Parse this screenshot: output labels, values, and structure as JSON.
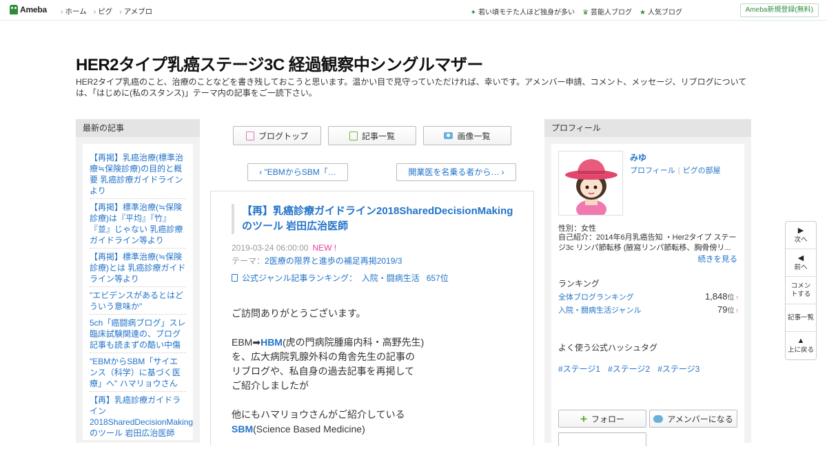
{
  "topbar": {
    "logo": "Ameba",
    "nav": [
      "ホーム",
      "ピグ",
      "アメブロ"
    ],
    "right_links": [
      {
        "icon": "sparkle-icon",
        "label": "若い頃モテた人ほど独身が多い"
      },
      {
        "icon": "crown-icon",
        "label": "芸能人ブログ"
      },
      {
        "icon": "star-icon",
        "label": "人気ブログ"
      }
    ],
    "signup": "Ameba新規登録(無料)"
  },
  "blog": {
    "title": "HER2タイプ乳癌ステージ3C 経過観察中シングルマザー",
    "description": "HER2タイプ乳癌のこと、治療のことなどを書き残しておこうと思います。温かい目で見守っていただければ、幸いです。アメンバー申請、コメント、メッセージ、リブログについては、「はじめに(私のスタンス)」テーマ内の記事をご一読下さい。"
  },
  "left": {
    "heading": "最新の記事",
    "recent": [
      "【再掲】乳癌治療(標準治療≒保険診療)の目的と概要 乳癌診療ガイドライン より",
      "【再掲】標準治療(≒保険診療)は『平均』『竹』『並』じゃない 乳癌診療ガイドライン等より",
      "【再掲】標準治療(≒保険診療)とは 乳癌診療ガイドライン等より",
      "\"エビデンスがあるとはどういう意味か\"",
      "5ch「癌闘病ブログ」スレ臨床試験関連の、ブログ記事も読まずの酷い中傷",
      "\"EBMからSBM「サイエンス（科学）に基づく医療」へ\" ハマリョウさん",
      "【再】乳癌診療ガイドライン2018SharedDecisionMakingのツール 岩田広治医師"
    ]
  },
  "main": {
    "buttons": {
      "top": "ブログトップ",
      "list": "記事一覧",
      "images": "画像一覧"
    },
    "prev": "\"EBMからSBM「…",
    "next": "開業医を名乗る者から…",
    "article": {
      "title": "【再】乳癌診療ガイドライン2018SharedDecisionMakingのツール 岩田広治医師",
      "date": "2019-03-24 06:00:00",
      "new_label": "NEW !",
      "theme_label": "テーマ：",
      "theme": "2医療の限界と進歩の補足再掲2019/3",
      "ranking": "公式ジャンル記事ランキング：  入院・闘病生活   657位",
      "p1": "ご訪問ありがとうございます。",
      "p2_pre": "EBM➡",
      "p2_link": "HBM",
      "p2_post": "(虎の門病院腫瘍内科・高野先生)",
      "p2_l2": "を、広大病院乳腺外科の角舎先生の記事の",
      "p2_l3": "リブログや、私自身の過去記事を再掲して",
      "p2_l4": "ご紹介しましたが",
      "p3_l1": "他にもハマリョウさんがご紹介している",
      "p3_link": "SBM",
      "p3_post": "(Science Based Medicine)"
    }
  },
  "right": {
    "heading": "プロフィール",
    "name": "みゆ",
    "profile_link": "プロフィール",
    "pig_link": "ピグの部屋",
    "gender": "性別：女性",
    "intro": "自己紹介：2014年6月乳癌告知 ・Her2タイプ ステージ3c リンパ節転移 (腋窩リンパ節転移、胸骨傍リ...",
    "more": "続きを見る",
    "ranking_heading": "ランキング",
    "rankings": [
      {
        "label": "全体ブログランキング",
        "value": "1,848",
        "unit": "位",
        "trend": "↑"
      },
      {
        "label": "入院・闘病生活ジャンル",
        "value": "79",
        "unit": "位",
        "trend": "↑"
      }
    ],
    "hashtag_heading": "よく使う公式ハッシュタグ",
    "hashtags": [
      "#ステージ1",
      "#ステージ2",
      "#ステージ3"
    ],
    "follow": "フォロー",
    "member": "アメンバーになる"
  },
  "floatnav": [
    {
      "icon": "triangle-right-icon",
      "label": "次へ"
    },
    {
      "icon": "triangle-left-icon",
      "label": "前へ"
    },
    {
      "icon": "",
      "label": "コメントする"
    },
    {
      "icon": "",
      "label": "記事一覧"
    },
    {
      "icon": "triangle-up-icon",
      "label": "上に戻る"
    }
  ],
  "colors": {
    "link": "#2273c9",
    "brand": "#2d8c3c",
    "new": "#e8399a",
    "sidebar_bg": "#f2f2f2"
  }
}
